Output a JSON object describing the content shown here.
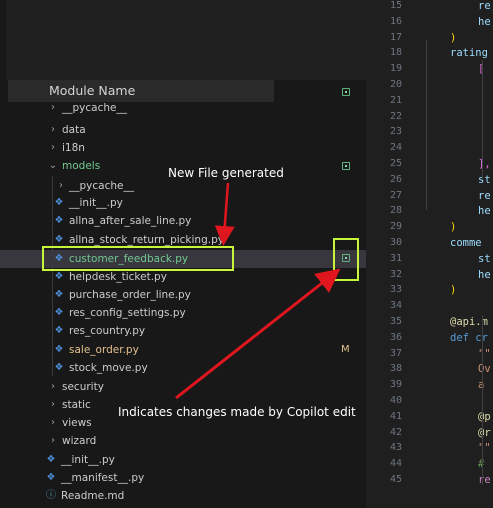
{
  "explorer": {
    "section_title": "Module Name",
    "items": [
      {
        "label": "__pycache__",
        "kind": "folder",
        "state": "collapsed"
      },
      {
        "label": "data",
        "kind": "folder",
        "state": "collapsed"
      },
      {
        "label": "i18n",
        "kind": "folder",
        "state": "collapsed"
      },
      {
        "label": "models",
        "kind": "folder",
        "state": "expanded"
      },
      {
        "label": "__pycache__",
        "kind": "folder",
        "state": "collapsed"
      },
      {
        "label": "__init__.py",
        "kind": "file"
      },
      {
        "label": "allna_after_sale_line.py",
        "kind": "file"
      },
      {
        "label": "allna_stock_return_picking.py",
        "kind": "file"
      },
      {
        "label": "customer_feedback.py",
        "kind": "file",
        "state": "selected"
      },
      {
        "label": "helpdesk_ticket.py",
        "kind": "file"
      },
      {
        "label": "purchase_order_line.py",
        "kind": "file"
      },
      {
        "label": "res_config_settings.py",
        "kind": "file"
      },
      {
        "label": "res_country.py",
        "kind": "file"
      },
      {
        "label": "sale_order.py",
        "kind": "file",
        "badge": "M"
      },
      {
        "label": "stock_move.py",
        "kind": "file"
      },
      {
        "label": "security",
        "kind": "folder",
        "state": "collapsed"
      },
      {
        "label": "static",
        "kind": "folder",
        "state": "collapsed"
      },
      {
        "label": "views",
        "kind": "folder",
        "state": "collapsed"
      },
      {
        "label": "wizard",
        "kind": "folder",
        "state": "collapsed"
      },
      {
        "label": "__init__.py",
        "kind": "file"
      },
      {
        "label": "__manifest__.py",
        "kind": "file"
      },
      {
        "label": "Readme.md",
        "kind": "file"
      }
    ]
  },
  "annotations": {
    "new_file": "New File generated",
    "copilot_changes": "Indicates changes made by Copilot edit"
  },
  "editor": {
    "line_numbers": [
      "15",
      "16",
      "17",
      "18",
      "19",
      "20",
      "21",
      "22",
      "23",
      "24",
      "25",
      "26",
      "27",
      "28",
      "29",
      "30",
      "31",
      "32",
      "33",
      "34",
      "35",
      "36",
      "37",
      "38",
      "39",
      "40",
      "41",
      "42",
      "43",
      "44",
      "45"
    ],
    "code_lines": [
      {
        "text": "re",
        "color": "#9cdcfe"
      },
      {
        "text": "he",
        "color": "#9cdcfe"
      },
      {
        "text": ")",
        "color": "#ffd700"
      },
      {
        "text": "rating",
        "color": "#9cdcfe"
      },
      {
        "text": "[",
        "color": "#da70d6"
      },
      {
        "text": "",
        "color": "#d4d4d4"
      },
      {
        "text": "",
        "color": "#d4d4d4"
      },
      {
        "text": "",
        "color": "#d4d4d4"
      },
      {
        "text": "",
        "color": "#d4d4d4"
      },
      {
        "text": "",
        "color": "#d4d4d4"
      },
      {
        "text": "],",
        "color": "#da70d6"
      },
      {
        "text": "st",
        "color": "#9cdcfe"
      },
      {
        "text": "re",
        "color": "#9cdcfe"
      },
      {
        "text": "he",
        "color": "#9cdcfe"
      },
      {
        "text": ")",
        "color": "#ffd700"
      },
      {
        "text": "comme",
        "color": "#9cdcfe"
      },
      {
        "text": "st",
        "color": "#9cdcfe"
      },
      {
        "text": "he",
        "color": "#9cdcfe"
      },
      {
        "text": ")",
        "color": "#ffd700"
      },
      {
        "text": "",
        "color": "#d4d4d4"
      },
      {
        "text": "@api.m",
        "color": "#dcdcaa"
      },
      {
        "text": "def cr",
        "color": "#569cd6"
      },
      {
        "text": "\"\"",
        "color": "#ce9178"
      },
      {
        "text": "Ov",
        "color": "#ce9178"
      },
      {
        "text": "a",
        "color": "#ce9178"
      },
      {
        "text": "",
        "color": "#d4d4d4"
      },
      {
        "text": "@p",
        "color": "#dcdcaa"
      },
      {
        "text": "@r",
        "color": "#dcdcaa"
      },
      {
        "text": "\"\"",
        "color": "#ce9178"
      },
      {
        "text": "#",
        "color": "#6a9955"
      },
      {
        "text": "re",
        "color": "#c586c0"
      }
    ]
  },
  "colors": {
    "accent_highlight": "#c6f53b",
    "arrow": "#e0161e",
    "added_file": "#73c991",
    "modified_file": "#e2c08d"
  }
}
